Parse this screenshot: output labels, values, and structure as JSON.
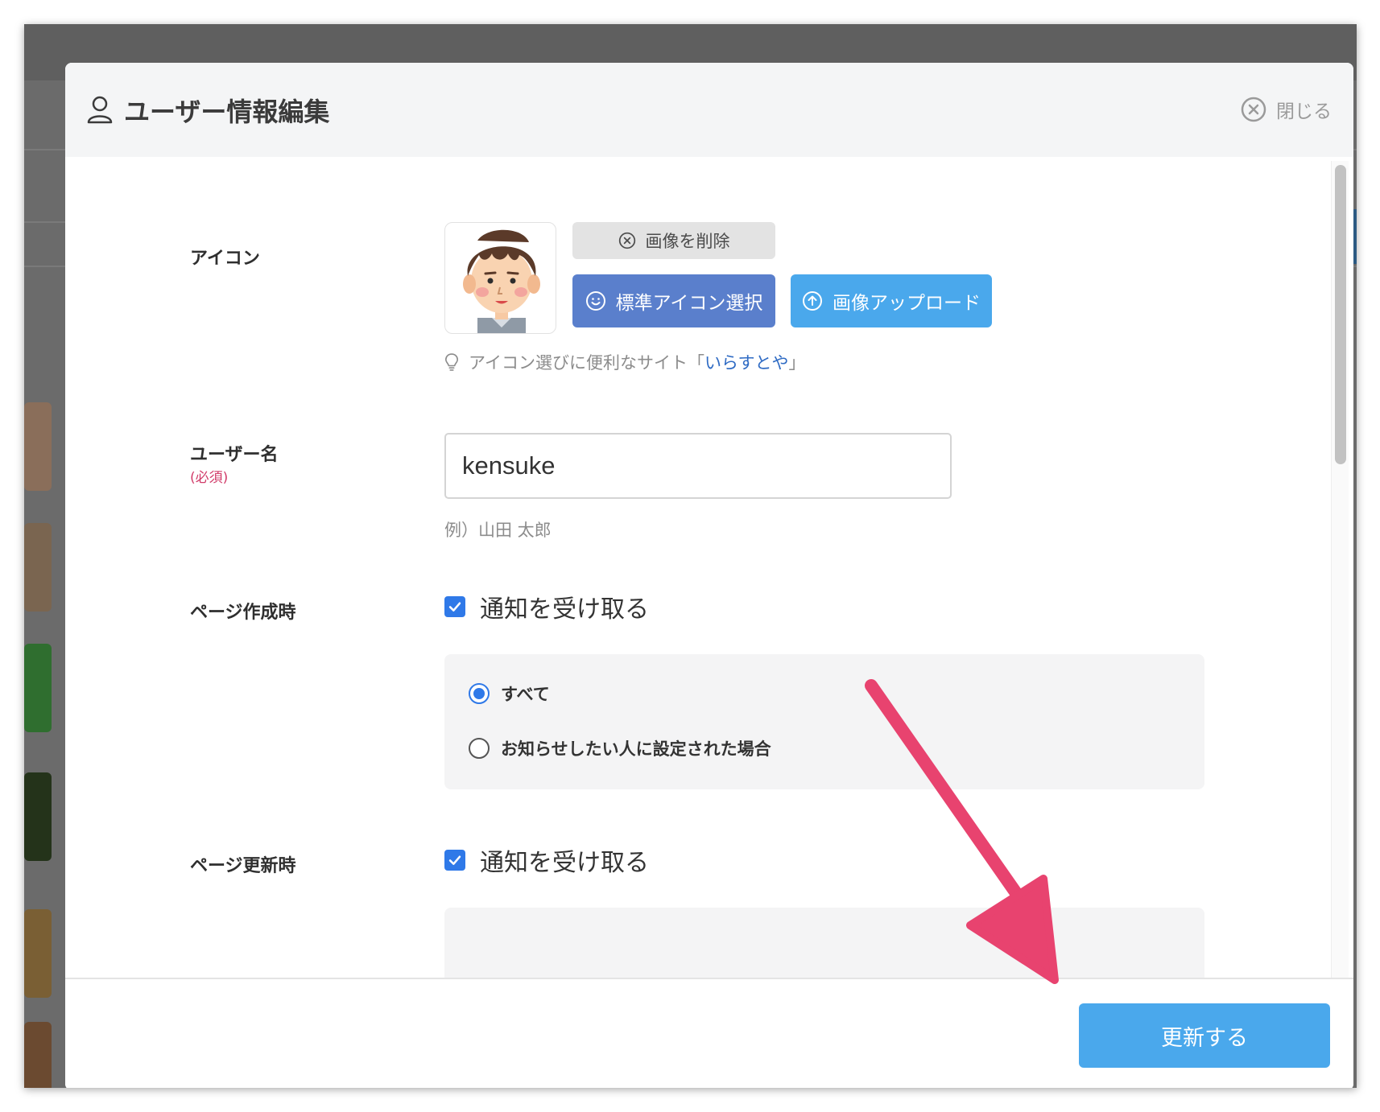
{
  "modal": {
    "title": "ユーザー情報編集",
    "close_label": "閉じる"
  },
  "icon_section": {
    "label": "アイコン",
    "delete_button": "画像を削除",
    "standard_icon_button": "標準アイコン選択",
    "upload_button": "画像アップロード",
    "hint_text": "アイコン選びに便利なサイト「",
    "hint_link": "いらすとや",
    "hint_close": "」"
  },
  "username": {
    "label": "ユーザー名",
    "required": "(必須)",
    "value": "kensuke",
    "example": "例）山田 太郎"
  },
  "page_create": {
    "label": "ページ作成時",
    "checkbox_label": "通知を受け取る",
    "checked": true,
    "options": [
      "すべて",
      "お知らせしたい人に設定された場合"
    ],
    "selected_option": "すべて"
  },
  "page_update": {
    "label": "ページ更新時",
    "checkbox_label": "通知を受け取る",
    "checked": true
  },
  "footer": {
    "submit_label": "更新する"
  },
  "colors": {
    "primary_blue": "#4aa8ec",
    "standard_icon_blue": "#5a7fcc",
    "checkbox_blue": "#2f79e8",
    "required_pink": "#d13c6a",
    "annotation_arrow": "#e8436f"
  },
  "icons": {
    "header": "user-icon",
    "close": "close-circle-icon",
    "delete": "close-circle-icon",
    "standard": "smile-icon",
    "upload": "upload-arrow-icon",
    "hint": "lightbulb-icon"
  }
}
